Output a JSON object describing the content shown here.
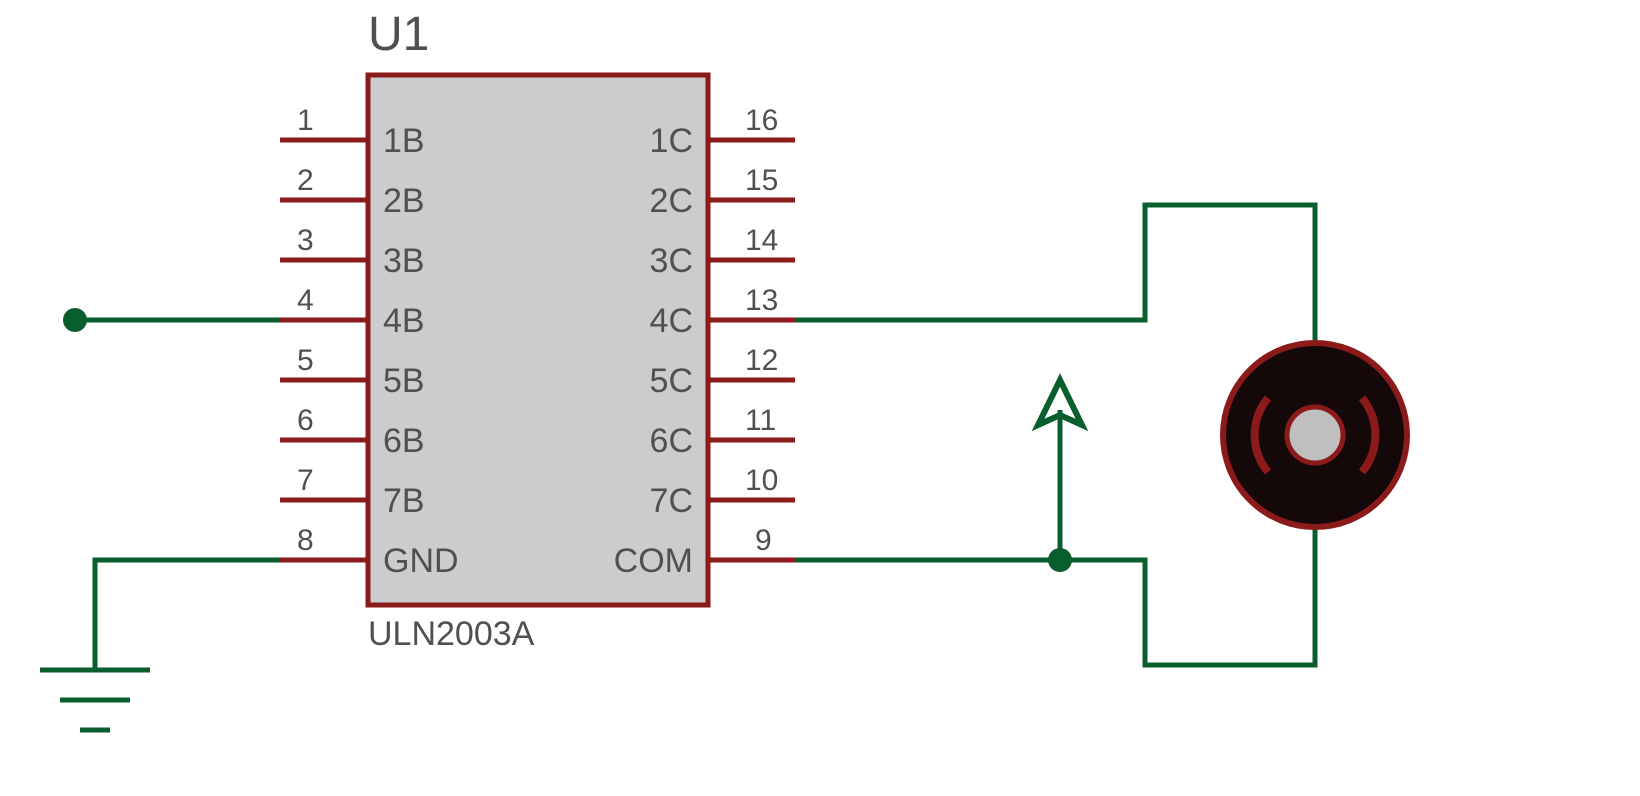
{
  "chip": {
    "reference": "U1",
    "part": "ULN2003A",
    "pins_left": [
      {
        "num": "1",
        "name": "1B"
      },
      {
        "num": "2",
        "name": "2B"
      },
      {
        "num": "3",
        "name": "3B"
      },
      {
        "num": "4",
        "name": "4B"
      },
      {
        "num": "5",
        "name": "5B"
      },
      {
        "num": "6",
        "name": "6B"
      },
      {
        "num": "7",
        "name": "7B"
      },
      {
        "num": "8",
        "name": "GND"
      }
    ],
    "pins_right": [
      {
        "num": "16",
        "name": "1C"
      },
      {
        "num": "15",
        "name": "2C"
      },
      {
        "num": "14",
        "name": "3C"
      },
      {
        "num": "13",
        "name": "4C"
      },
      {
        "num": "12",
        "name": "5C"
      },
      {
        "num": "11",
        "name": "6C"
      },
      {
        "num": "10",
        "name": "7C"
      },
      {
        "num": "9",
        "name": "COM"
      }
    ]
  },
  "symbols": {
    "ground": "ground",
    "vcc": "vcc-arrow",
    "buzzer": "buzzer"
  }
}
